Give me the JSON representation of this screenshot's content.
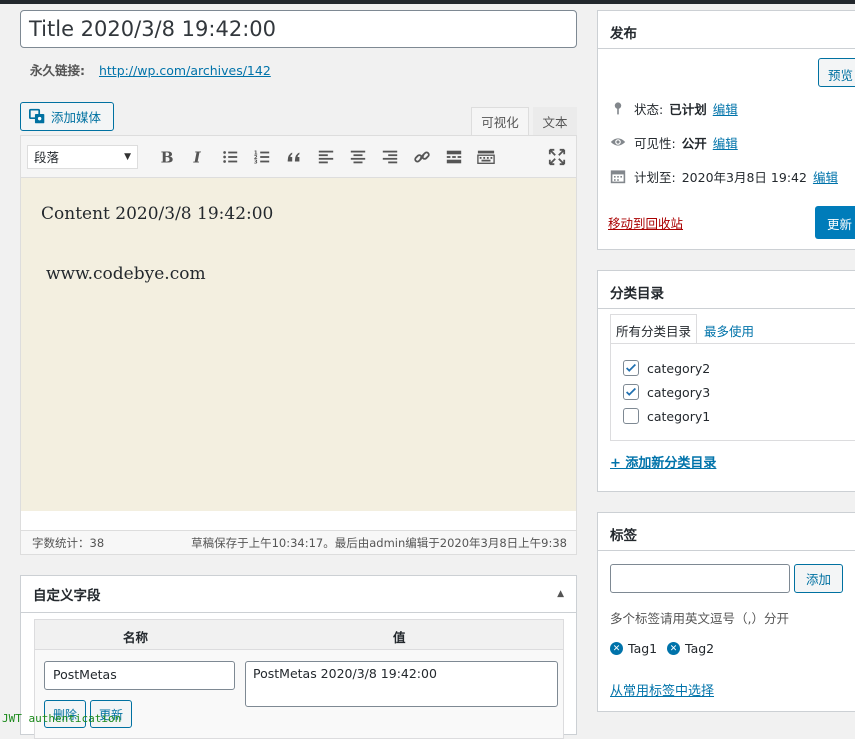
{
  "post": {
    "title": "Title 2020/3/8 19:42:00",
    "permalink_label": "永久链接:",
    "permalink_url": "http://wp.com/archives/142"
  },
  "editor": {
    "add_media": "添加媒体",
    "tab_visual": "可视化",
    "tab_text": "文本",
    "format_select": "段落",
    "content_line1": "Content 2020/3/8 19:42:00",
    "content_line2": "www.codebye.com",
    "word_count": "字数统计：38",
    "autosave": "草稿保存于上午10:34:17。最后由admin编辑于2020年3月8日上午9:38",
    "background": "#f3efe0"
  },
  "custom_fields": {
    "title": "自定义字段",
    "col_name": "名称",
    "col_value": "值",
    "name": "PostMetas",
    "value": "PostMetas 2020/3/8 19:42:00",
    "delete": "删除",
    "update": "更新"
  },
  "debug_text": "JWT authentication",
  "publish": {
    "title": "发布",
    "preview": "预览",
    "status_label": "状态:",
    "status_value": "已计划",
    "visibility_label": "可见性:",
    "visibility_value": "公开",
    "schedule_label": "计划至:",
    "schedule_value": "2020年3月8日 19:42",
    "edit": "编辑",
    "trash": "移动到回收站",
    "update": "更新",
    "accent": "#007cba"
  },
  "categories": {
    "title": "分类目录",
    "tab_all": "所有分类目录",
    "tab_popular": "最多使用",
    "items": [
      {
        "label": "category2",
        "checked": true
      },
      {
        "label": "category3",
        "checked": true
      },
      {
        "label": "category1",
        "checked": false
      }
    ],
    "add_new": "+ 添加新分类目录"
  },
  "tags": {
    "title": "标签",
    "input_value": "",
    "add": "添加",
    "hint": "多个标签请用英文逗号（,）分开",
    "items": [
      "Tag1",
      "Tag2"
    ],
    "choose": "从常用标签中选择"
  },
  "icons": [
    "media-icon",
    "bold-icon",
    "italic-icon",
    "bullet-list-icon",
    "numbered-list-icon",
    "quote-icon",
    "align-left-icon",
    "align-center-icon",
    "align-right-icon",
    "link-icon",
    "read-more-icon",
    "toolbar-toggle-icon",
    "fullscreen-icon",
    "pin-icon",
    "eye-icon",
    "calendar-icon",
    "check-icon",
    "remove-tag-icon",
    "collapse-arrow-icon"
  ]
}
